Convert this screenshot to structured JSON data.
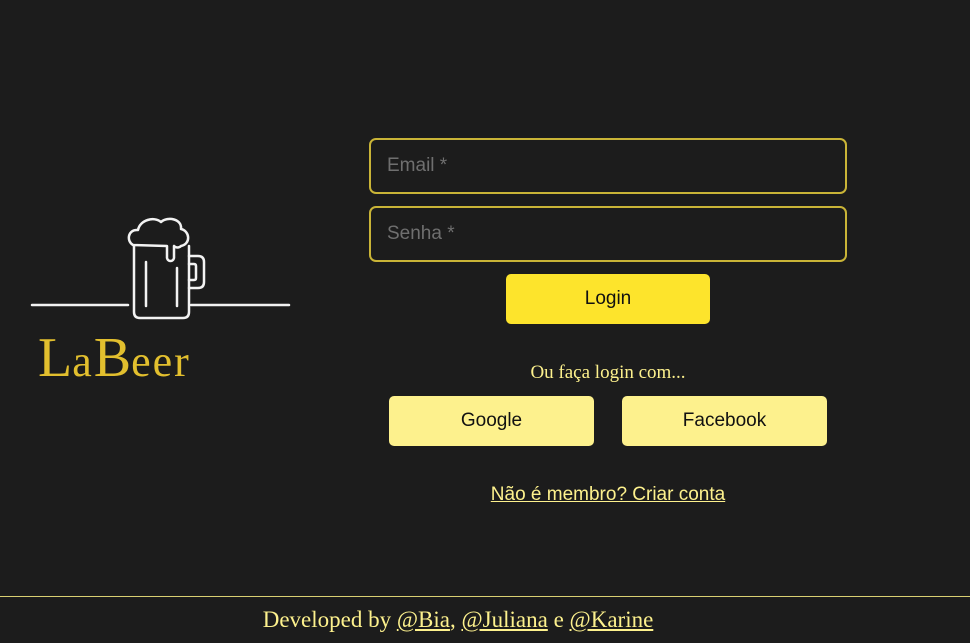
{
  "logo": {
    "brand": "LaBeer",
    "brand_parts": [
      "L",
      "a",
      "B",
      "eer"
    ]
  },
  "login_form": {
    "email_placeholder": "Email *",
    "password_placeholder": "Senha *",
    "login_label": "Login"
  },
  "social": {
    "prompt": "Ou faça login com...",
    "google_label": "Google",
    "facebook_label": "Facebook"
  },
  "signup": {
    "link_text": "Não é membro? Criar conta"
  },
  "footer": {
    "prefix": "Developed by ",
    "dev1": "@Bia",
    "sep1": ", ",
    "dev2": "@Juliana",
    "sep2": " e ",
    "dev3": "@Karine"
  },
  "colors": {
    "background": "#1c1c1c",
    "accent_gold": "#e2bf2e",
    "primary_button": "#fde42c",
    "secondary_button": "#fdf18d",
    "input_border": "#c9b437"
  },
  "icons": {
    "logo_icon": "beer-mug-icon"
  }
}
